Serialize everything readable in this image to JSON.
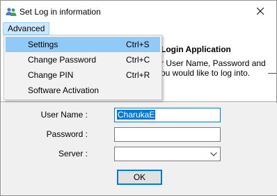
{
  "window": {
    "title": "Set Log in information",
    "icon": "users-icon"
  },
  "menubar": {
    "advanced_label": "Advanced"
  },
  "menu": {
    "items": [
      {
        "label": "Settings",
        "shortcut": "Ctrl+S",
        "highlighted": true
      },
      {
        "label": "Change Password",
        "shortcut": "Ctrl+C",
        "highlighted": false
      },
      {
        "label": "Change PIN",
        "shortcut": "Ctrl+R",
        "highlighted": false
      },
      {
        "label": "Software Activation",
        "shortcut": "",
        "highlighted": false
      }
    ]
  },
  "header": {
    "title": "Login Application",
    "description": "r User Name, Password and ou would like to log into."
  },
  "form": {
    "user_label": "User Name :",
    "user_value": "CharukaE",
    "password_label": "Password :",
    "password_value": "",
    "server_label": "Server :",
    "server_value": "",
    "ok_label": "OK"
  },
  "colors": {
    "menu_highlight": "#91c9f7",
    "menubar_active": "#cce8ff",
    "focus_border": "#0078d7",
    "form_background": "#f0f0f0"
  }
}
